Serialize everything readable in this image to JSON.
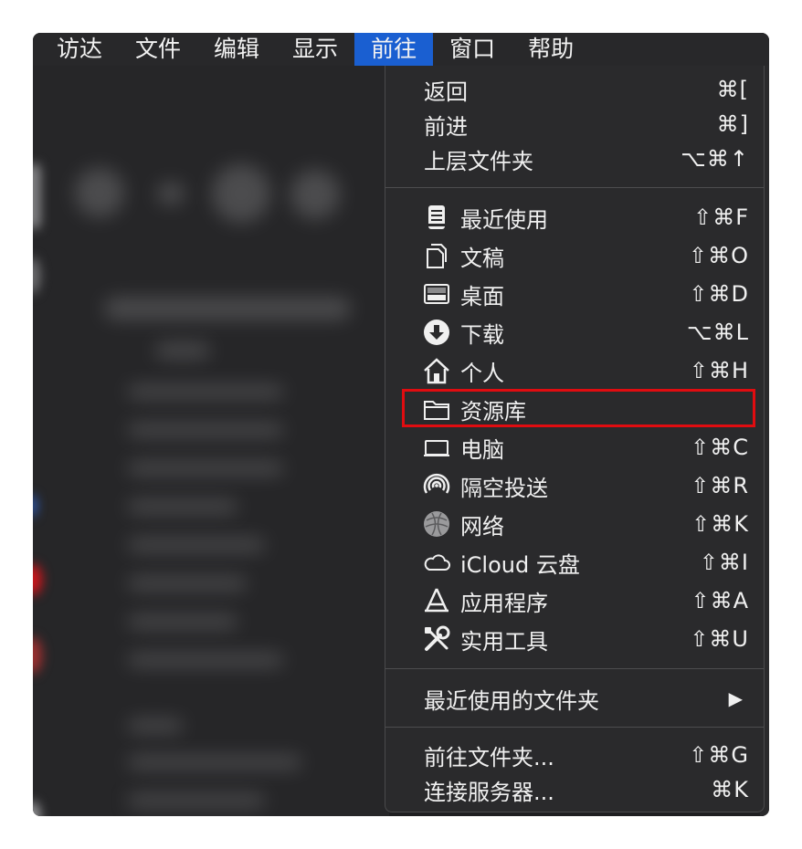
{
  "menubar": {
    "items": [
      {
        "label": "访达",
        "active": false
      },
      {
        "label": "文件",
        "active": false
      },
      {
        "label": "编辑",
        "active": false
      },
      {
        "label": "显示",
        "active": false
      },
      {
        "label": "前往",
        "active": true
      },
      {
        "label": "窗口",
        "active": false
      },
      {
        "label": "帮助",
        "active": false
      }
    ]
  },
  "go_menu": {
    "history": [
      {
        "label": "返回",
        "shortcut": "⌘["
      },
      {
        "label": "前进",
        "shortcut": "⌘]"
      },
      {
        "label": "上层文件夹",
        "shortcut": "⌥⌘↑"
      }
    ],
    "locations": [
      {
        "label": "最近使用",
        "shortcut": "⇧⌘F",
        "icon": "recents-icon"
      },
      {
        "label": "文稿",
        "shortcut": "⇧⌘O",
        "icon": "documents-icon"
      },
      {
        "label": "桌面",
        "shortcut": "⇧⌘D",
        "icon": "desktop-icon"
      },
      {
        "label": "下载",
        "shortcut": "⌥⌘L",
        "icon": "downloads-icon"
      },
      {
        "label": "个人",
        "shortcut": "⇧⌘H",
        "icon": "home-icon"
      },
      {
        "label": "资源库",
        "shortcut": "",
        "icon": "folder-icon"
      },
      {
        "label": "电脑",
        "shortcut": "⇧⌘C",
        "icon": "computer-icon"
      },
      {
        "label": "隔空投送",
        "shortcut": "⇧⌘R",
        "icon": "airdrop-icon"
      },
      {
        "label": "网络",
        "shortcut": "⇧⌘K",
        "icon": "network-icon"
      },
      {
        "label": "iCloud 云盘",
        "shortcut": "⇧⌘I",
        "icon": "icloud-icon"
      },
      {
        "label": "应用程序",
        "shortcut": "⇧⌘A",
        "icon": "applications-icon"
      },
      {
        "label": "实用工具",
        "shortcut": "⇧⌘U",
        "icon": "utilities-icon"
      }
    ],
    "recent_folders": {
      "label": "最近使用的文件夹",
      "submenu_arrow": "▶"
    },
    "footer": [
      {
        "label": "前往文件夹...",
        "shortcut": "⇧⌘G"
      },
      {
        "label": "连接服务器...",
        "shortcut": "⌘K"
      }
    ],
    "highlighted_item": "资源库",
    "highlight_color": "#e00c10",
    "active_menu_color": "#1a5fd1"
  }
}
